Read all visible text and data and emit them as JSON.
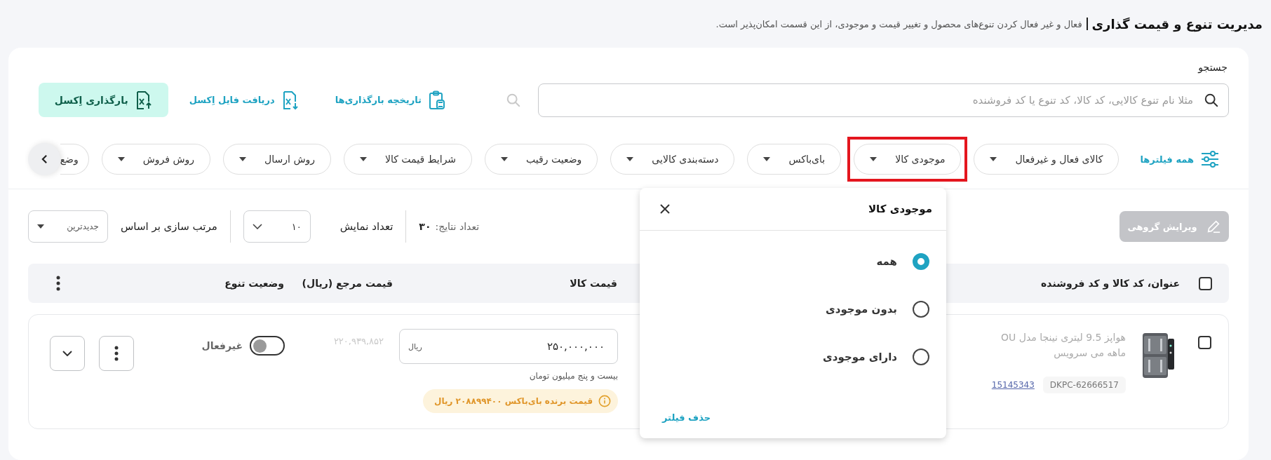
{
  "header": {
    "title": "مدیریت تنوع و قیمت گذاری",
    "description": "فعال و غیر فعال کردن تنوع‌های محصول و تغییر قیمت و موجودی، از این قسمت امکان‌پذیر است."
  },
  "search": {
    "label": "جستجو",
    "placeholder": "مثلا نام تنوع کالایی، کد کالا، کد تنوع یا کد فروشنده"
  },
  "actions": [
    {
      "kind": "link",
      "label": "تاریخچه بارگذاری‌ها"
    },
    {
      "kind": "link",
      "label": "دریافت فایل اِکسل"
    },
    {
      "kind": "primary",
      "label": "بارگذاری اِکسل"
    }
  ],
  "all_filters": "همه فیلترها",
  "filters": [
    {
      "label": "کالای فعال و غیرفعال",
      "highlighted": false
    },
    {
      "label": "موجودی کالا",
      "highlighted": true
    },
    {
      "label": "بای‌باکس",
      "highlighted": false
    },
    {
      "label": "دسته‌بندی کالایی",
      "highlighted": false
    },
    {
      "label": "وضعیت رقیب",
      "highlighted": false
    },
    {
      "label": "شرایط قیمت کالا",
      "highlighted": false
    },
    {
      "label": "روش ارسال",
      "highlighted": false
    },
    {
      "label": "روش فروش",
      "highlighted": false
    },
    {
      "label": "وضع",
      "highlighted": false
    }
  ],
  "toolbar": {
    "bulk_edit": {
      "label": "ویرایش گروهی",
      "disabled": true
    },
    "results_label": "تعداد نتایج:",
    "results_count": "۳۰",
    "page_size_label": "تعداد نمایش",
    "page_size": "۱۰",
    "sort_label": "مرتب سازی بر اساس",
    "sort_value": "جدیدترین"
  },
  "table": {
    "header_checked": false,
    "columns": [
      "عنوان، کد کالا و کد فروشنده",
      "قیمت کالا",
      "قیمت مرجع (ریال)",
      "وضعیت تنوع"
    ],
    "rows": [
      {
        "checked": false,
        "title": "هواپز 9.5 لیتری نینجا مدل OU",
        "title_line_2": "ماهه می سرویس",
        "product_code": "DKPC-62666517",
        "seller_code": "15145343",
        "price": "۲۵۰,۰۰۰,۰۰۰",
        "currency": "ریال",
        "price_in_words": "بیست و پنج میلیون تومان",
        "buybox_note": "قیمت برنده بای‌باکس ۲۰۸۸۹۹۴۰۰ ریال",
        "reference_price": "۲۲۰,۹۳۹,۸۵۲",
        "active": false,
        "status_label": "غیرفعال"
      }
    ]
  },
  "popup": {
    "title": "موجودی کالا",
    "options": [
      {
        "label": "همه",
        "selected": true
      },
      {
        "label": "بدون موجودی",
        "selected": false
      },
      {
        "label": "دارای موجودی",
        "selected": false
      }
    ],
    "clear_label": "حذف فیلتر"
  }
}
